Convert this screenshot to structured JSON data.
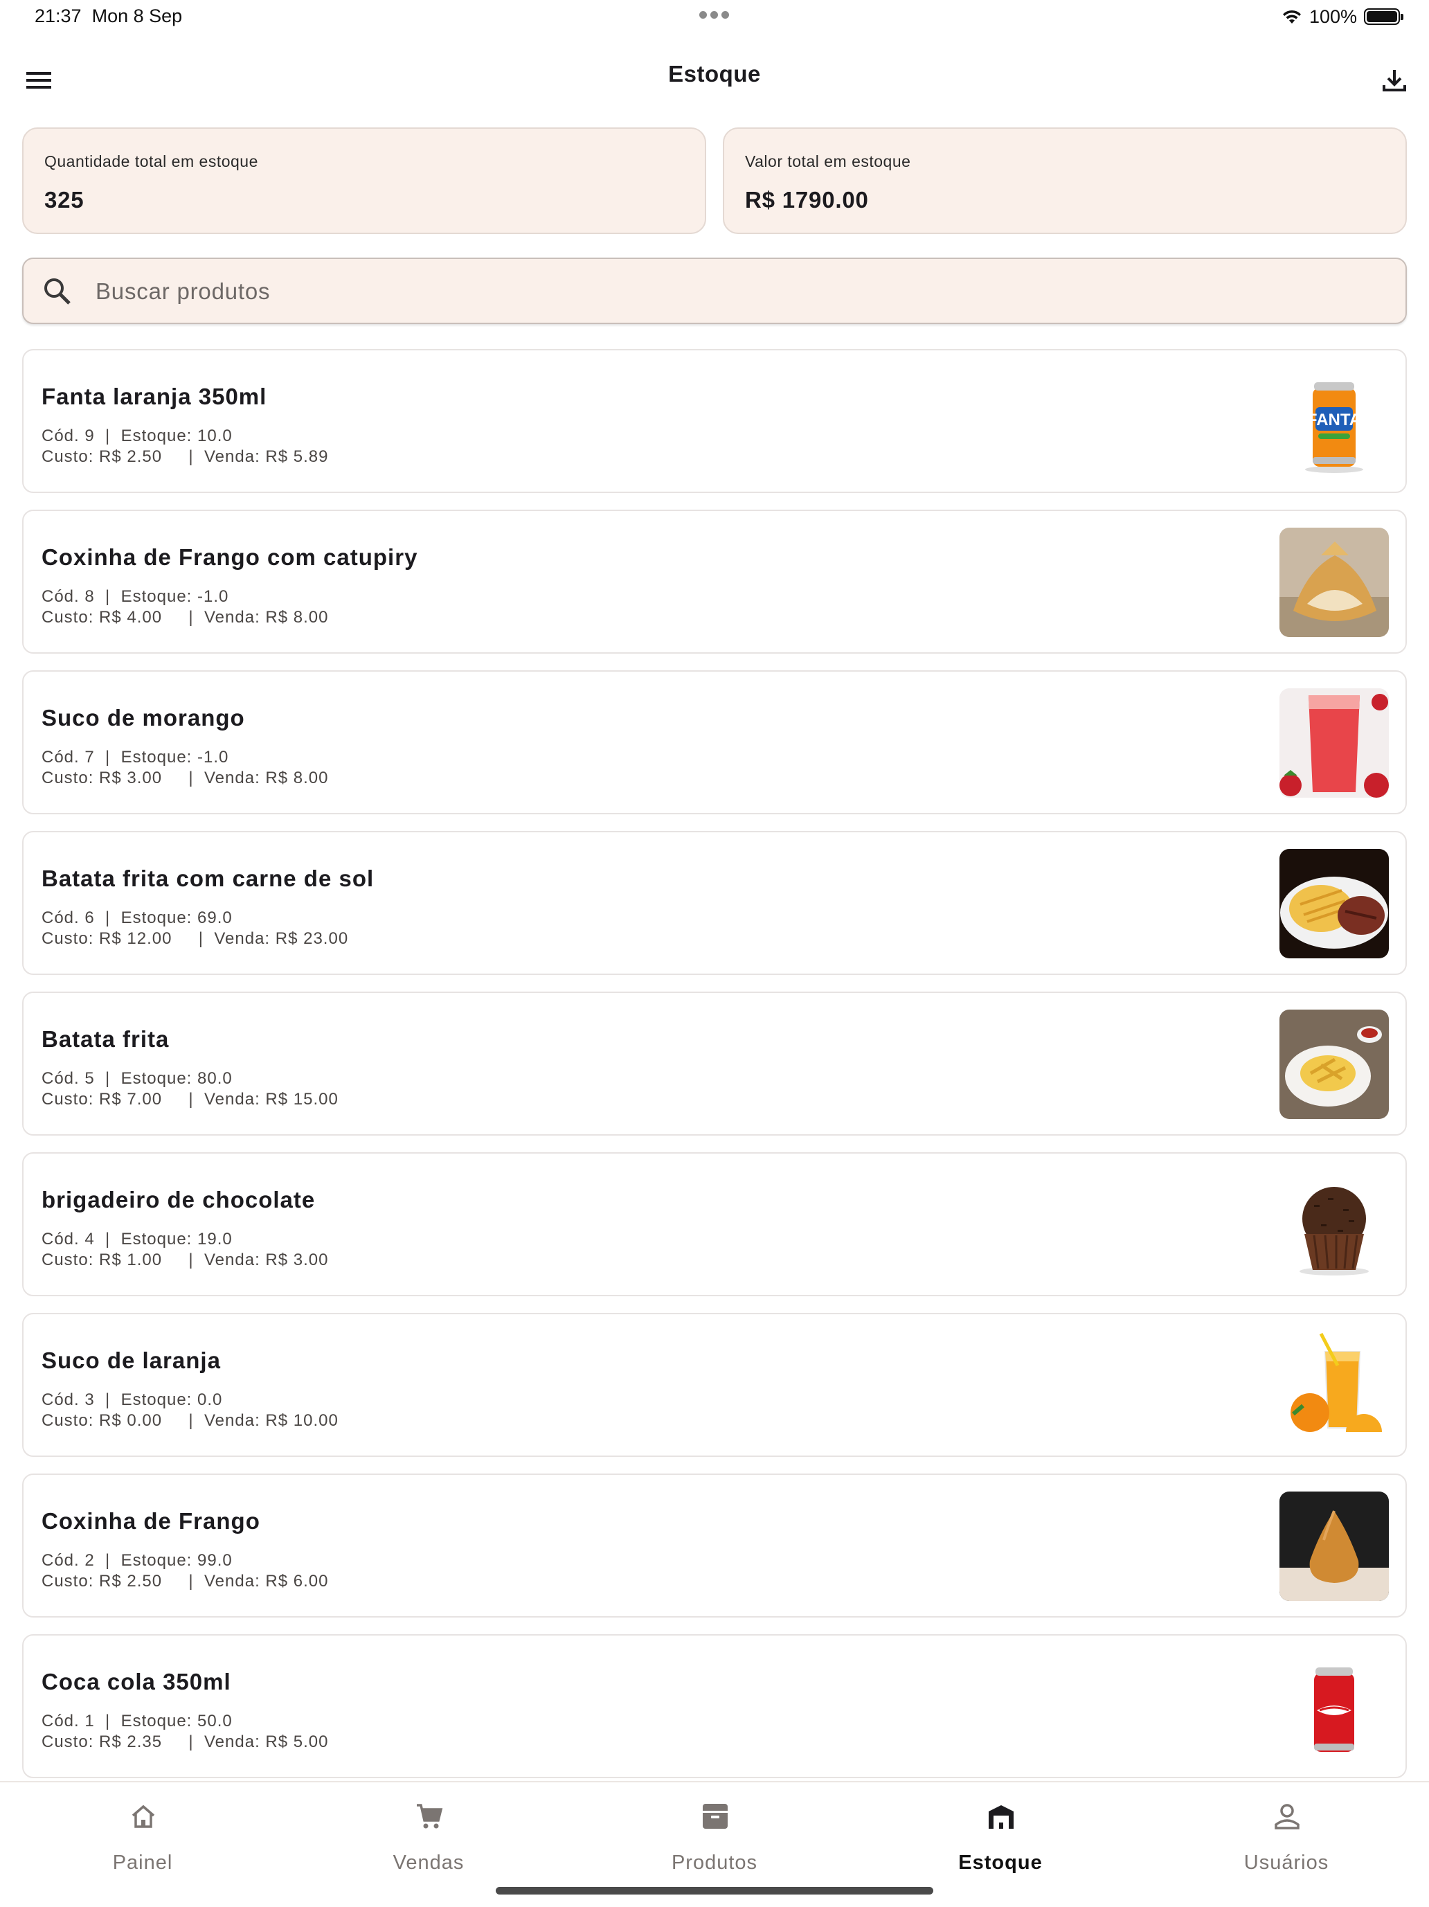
{
  "status_bar": {
    "time": "21:37",
    "date": "Mon 8 Sep",
    "battery": "100%"
  },
  "app_bar": {
    "title": "Estoque",
    "menu_icon": "menu-icon",
    "download_icon": "download-icon"
  },
  "summary": {
    "quantity_label": "Quantidade total em estoque",
    "quantity_value": "325",
    "value_label": "Valor total em estoque",
    "value_value": "R$ 1790.00"
  },
  "search": {
    "placeholder": "Buscar produtos",
    "value": ""
  },
  "products": [
    {
      "name": "Fanta laranja 350ml",
      "meta1": "Cód. 9  |  Estoque: 10.0",
      "meta2": "Custo: R$ 2.50     |  Venda: R$ 5.89",
      "image": "fanta-can"
    },
    {
      "name": "Coxinha de Frango com catupiry",
      "meta1": "Cód. 8  |  Estoque: -1.0",
      "meta2": "Custo: R$ 4.00     |  Venda: R$ 8.00",
      "image": "coxinha-catupiry"
    },
    {
      "name": "Suco de morango",
      "meta1": "Cód. 7  |  Estoque: -1.0",
      "meta2": "Custo: R$ 3.00     |  Venda: R$ 8.00",
      "image": "strawberry-juice"
    },
    {
      "name": "Batata frita com carne de sol",
      "meta1": "Cód. 6  |  Estoque: 69.0",
      "meta2": "Custo: R$ 12.00     |  Venda: R$ 23.00",
      "image": "fries-with-meat"
    },
    {
      "name": "Batata frita",
      "meta1": "Cód. 5  |  Estoque: 80.0",
      "meta2": "Custo: R$ 7.00     |  Venda: R$ 15.00",
      "image": "fries"
    },
    {
      "name": "brigadeiro de chocolate",
      "meta1": "Cód. 4  |  Estoque: 19.0",
      "meta2": "Custo: R$ 1.00     |  Venda: R$ 3.00",
      "image": "brigadeiro"
    },
    {
      "name": "Suco de laranja",
      "meta1": "Cód. 3  |  Estoque: 0.0",
      "meta2": "Custo: R$ 0.00     |  Venda: R$ 10.00",
      "image": "orange-juice"
    },
    {
      "name": "Coxinha de Frango",
      "meta1": "Cód. 2  |  Estoque: 99.0",
      "meta2": "Custo: R$ 2.50     |  Venda: R$ 6.00",
      "image": "coxinha"
    },
    {
      "name": "Coca cola 350ml",
      "meta1": "Cód. 1  |  Estoque: 50.0",
      "meta2": "Custo: R$ 2.35     |  Venda: R$ 5.00",
      "image": "coca-cola-can"
    }
  ],
  "bottom_nav": [
    {
      "label": "Painel",
      "icon": "home-icon",
      "active": false
    },
    {
      "label": "Vendas",
      "icon": "cart-icon",
      "active": false
    },
    {
      "label": "Produtos",
      "icon": "archive-icon",
      "active": false
    },
    {
      "label": "Estoque",
      "icon": "warehouse-icon",
      "active": true
    },
    {
      "label": "Usuários",
      "icon": "person-icon",
      "active": false
    }
  ],
  "colors": {
    "card_bg": "#faf0ea",
    "accent_text": "#1c1b1f",
    "inactive_nav": "#7b7572"
  }
}
